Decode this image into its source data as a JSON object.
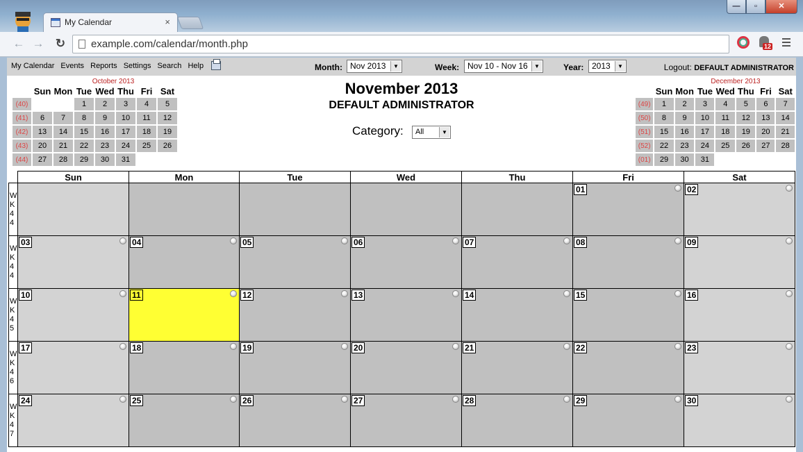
{
  "browser": {
    "tab_title": "My Calendar",
    "tab_close": "×",
    "url": "example.com/calendar/month.php",
    "notification_count": "12",
    "window_buttons": {
      "minimize": "—",
      "maximize": "▫",
      "close": "✕"
    },
    "nav": {
      "back": "←",
      "forward": "→",
      "reload": "↻"
    }
  },
  "menu": {
    "items": [
      "My Calendar",
      "Events",
      "Reports",
      "Settings",
      "Search",
      "Help"
    ],
    "month_label": "Month:",
    "month_value": "Nov 2013",
    "week_label": "Week:",
    "week_value": "Nov 10 - Nov 16",
    "year_label": "Year:",
    "year_value": "2013",
    "logout_label": "Logout:",
    "logout_user": "DEFAULT ADMINISTRATOR",
    "dropdown_arrow": "▼"
  },
  "header": {
    "title": "November 2013",
    "user": "DEFAULT ADMINISTRATOR",
    "category_label": "Category:",
    "category_value": "All"
  },
  "mini_prev": {
    "title": "October 2013",
    "days": [
      "Sun",
      "Mon",
      "Tue",
      "Wed",
      "Thu",
      "Fri",
      "Sat"
    ],
    "weeks": [
      {
        "wk": "(40)",
        "days": [
          "",
          "",
          "1",
          "2",
          "3",
          "4",
          "5"
        ]
      },
      {
        "wk": "(41)",
        "days": [
          "6",
          "7",
          "8",
          "9",
          "10",
          "11",
          "12"
        ]
      },
      {
        "wk": "(42)",
        "days": [
          "13",
          "14",
          "15",
          "16",
          "17",
          "18",
          "19"
        ]
      },
      {
        "wk": "(43)",
        "days": [
          "20",
          "21",
          "22",
          "23",
          "24",
          "25",
          "26"
        ]
      },
      {
        "wk": "(44)",
        "days": [
          "27",
          "28",
          "29",
          "30",
          "31",
          "",
          ""
        ]
      }
    ]
  },
  "mini_next": {
    "title": "December 2013",
    "days": [
      "Sun",
      "Mon",
      "Tue",
      "Wed",
      "Thu",
      "Fri",
      "Sat"
    ],
    "weeks": [
      {
        "wk": "(49)",
        "days": [
          "1",
          "2",
          "3",
          "4",
          "5",
          "6",
          "7"
        ]
      },
      {
        "wk": "(50)",
        "days": [
          "8",
          "9",
          "10",
          "11",
          "12",
          "13",
          "14"
        ]
      },
      {
        "wk": "(51)",
        "days": [
          "15",
          "16",
          "17",
          "18",
          "19",
          "20",
          "21"
        ]
      },
      {
        "wk": "(52)",
        "days": [
          "22",
          "23",
          "24",
          "25",
          "26",
          "27",
          "28"
        ]
      },
      {
        "wk": "(01)",
        "days": [
          "29",
          "30",
          "31",
          "",
          "",
          "",
          ""
        ]
      }
    ]
  },
  "month": {
    "days": [
      "Sun",
      "Mon",
      "Tue",
      "Wed",
      "Thu",
      "Fri",
      "Sat"
    ],
    "today": "11",
    "weeks": [
      {
        "wk": "WK44",
        "days": [
          "",
          "",
          "",
          "",
          "",
          "01",
          "02"
        ]
      },
      {
        "wk": "WK44",
        "days": [
          "03",
          "04",
          "05",
          "06",
          "07",
          "08",
          "09"
        ]
      },
      {
        "wk": "WK45",
        "days": [
          "10",
          "11",
          "12",
          "13",
          "14",
          "15",
          "16"
        ]
      },
      {
        "wk": "WK46",
        "days": [
          "17",
          "18",
          "19",
          "20",
          "21",
          "22",
          "23"
        ]
      },
      {
        "wk": "WK47",
        "days": [
          "24",
          "25",
          "26",
          "27",
          "28",
          "29",
          "30"
        ]
      }
    ]
  },
  "colors": {
    "weekday_cell": "#c0c0c0",
    "weekend_cell": "#d3d3d3",
    "today_cell": "#ffff33",
    "week_number": "#dd4444",
    "mini_title": "#bb2222"
  }
}
